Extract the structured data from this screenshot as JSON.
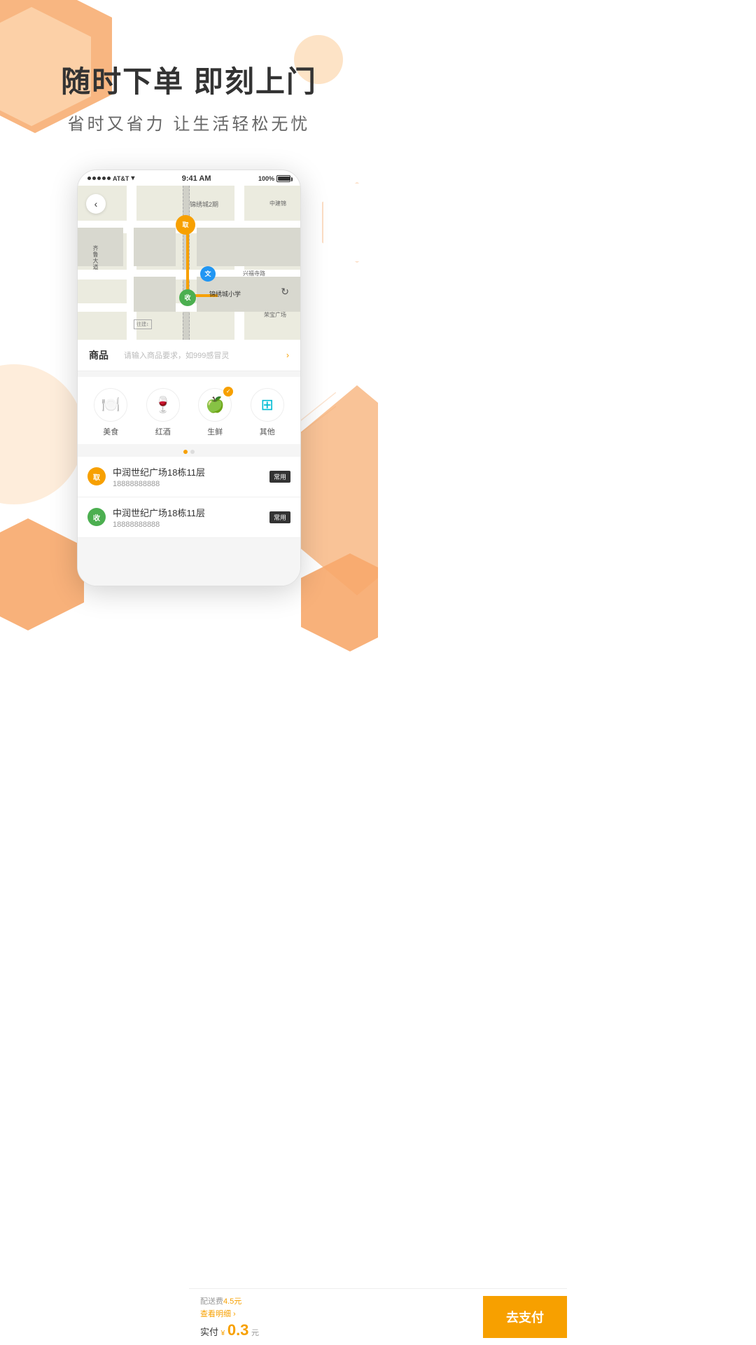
{
  "hero": {
    "title": "随时下单 即刻上门",
    "subtitle": "省时又省力   让生活轻松无忧"
  },
  "status_bar": {
    "carrier": "AT&T",
    "time": "9:41 AM",
    "battery": "100%"
  },
  "map": {
    "back_label": "‹",
    "label_1": "锦绣城2期",
    "label_2": "中建锦",
    "label_3": "齐鲁大道",
    "label_4": "锦绣城小学",
    "label_5": "兴福寺路",
    "label_6": "荣宝广场",
    "label_7": "往建↕",
    "pin_pickup_label": "取",
    "pin_delivery_label": "收",
    "pin_blue_label": "文"
  },
  "product": {
    "label": "商品",
    "hint": "请输入商品要求，如999感冒灵"
  },
  "categories": [
    {
      "icon": "🍽️",
      "label": "美食",
      "checked": false
    },
    {
      "icon": "🍷",
      "label": "红酒",
      "checked": false
    },
    {
      "icon": "🍏",
      "label": "生鲜",
      "checked": true
    },
    {
      "icon": "⊞",
      "label": "其他",
      "checked": false
    }
  ],
  "addresses": [
    {
      "type": "pickup",
      "label": "取",
      "address": "中润世纪广场18栋11层",
      "phone": "18888888888",
      "tag": "常用"
    },
    {
      "type": "delivery",
      "label": "收",
      "address": "中润世纪广场18栋11层",
      "phone": "18888888888",
      "tag": "常用"
    }
  ],
  "bottom_bar": {
    "delivery_fee": "配送费4.5元",
    "detail_link": "查看明细 ›",
    "actual_label": "实付",
    "currency": "¥",
    "price": "0.3",
    "unit": "元",
    "pay_button": "去支付"
  },
  "colors": {
    "orange": "#F7A000",
    "green": "#4CAF50",
    "blue": "#2196F3",
    "light_orange": "#FDDCB8",
    "dark_orange": "#F7A96B"
  }
}
